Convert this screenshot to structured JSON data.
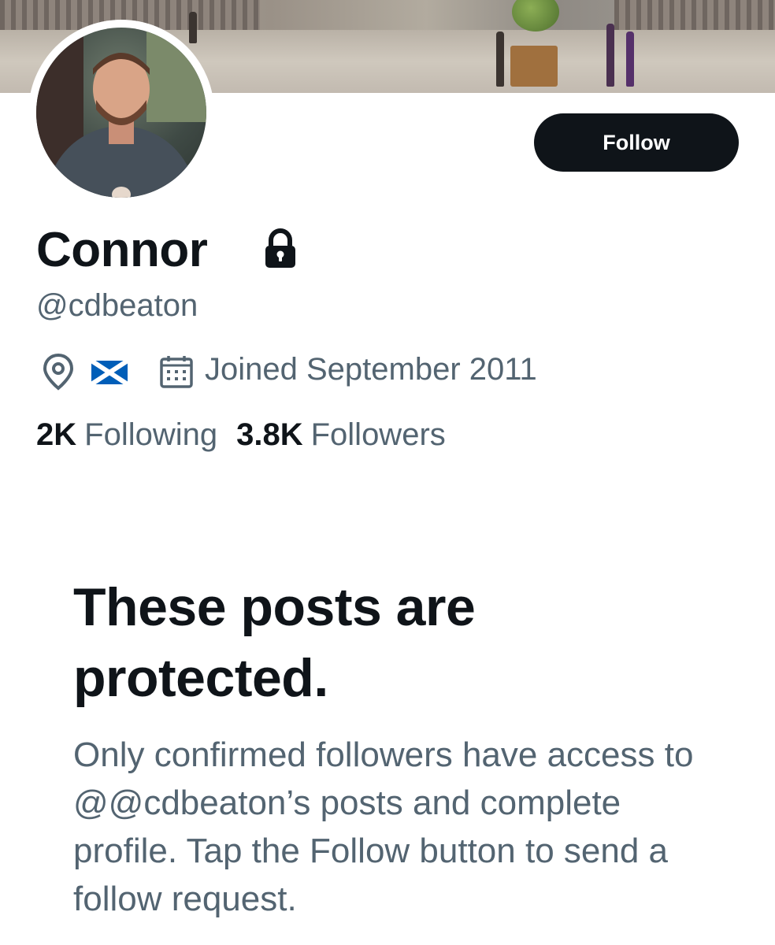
{
  "profile": {
    "name": "Connor",
    "handle": "@cdbeaton",
    "joined": "Joined September 2011",
    "location_flag": "Scotland flag",
    "protected": true
  },
  "actions": {
    "follow_label": "Follow"
  },
  "stats": {
    "following_count": "2K",
    "following_label": "Following",
    "followers_count": "3.8K",
    "followers_label": "Followers"
  },
  "protected_notice": {
    "title": "These posts are protected.",
    "body": "Only confirmed followers have access to @@cdbeaton’s posts and complete profile. Tap the Follow button to send a follow request."
  },
  "icons": {
    "lock": "lock-icon",
    "location": "location-pin-icon",
    "flag": "scotland-flag-icon",
    "calendar": "calendar-icon"
  },
  "colors": {
    "primary_text": "#0f1419",
    "secondary_text": "#536471",
    "button_bg": "#0f1419",
    "button_text": "#ffffff",
    "flag_blue": "#005EB8"
  }
}
